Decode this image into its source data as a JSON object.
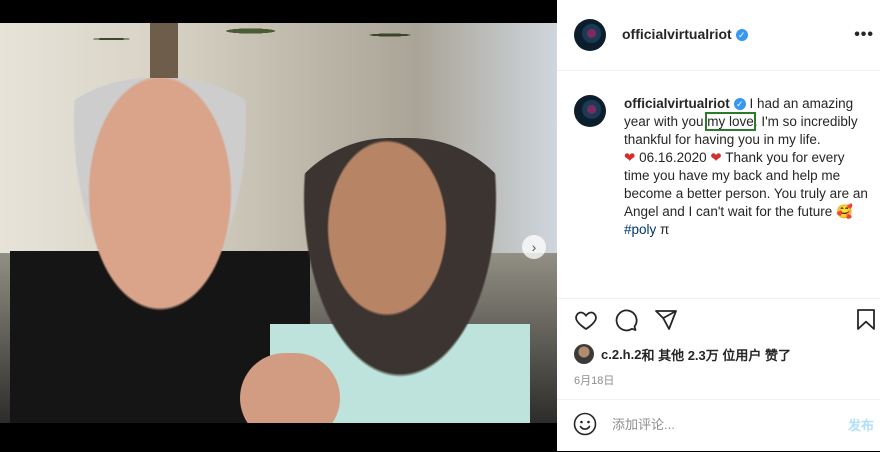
{
  "post": {
    "username": "officialvirtualriot",
    "caption": {
      "part1": "I had an amazing year with you ",
      "highlight": "my love",
      "part2": ". I'm so incredibly thankful for having you in my life.",
      "date_line": "06.16.2020",
      "part3": " Thank you for every time you have my back and help me become a better person. You truly are an Angel and I can't wait for the future",
      "hashtag": "#poly",
      "suffix": " π",
      "heart_emoji": "❤",
      "smile_emoji": "🥰"
    },
    "likes": {
      "liker": "c.2.h.2",
      "text": " 和 其他 2.3万 位用户 赞了"
    },
    "date": "6月18日"
  },
  "comment": {
    "placeholder": "添加评论...",
    "post_label": "发布"
  },
  "icons": {
    "more": "more-icon",
    "verified": "verified-badge-icon",
    "like": "heart-icon",
    "comment": "comment-icon",
    "share": "share-icon",
    "save": "bookmark-icon",
    "emoji": "emoji-icon",
    "next": "chevron-right-icon"
  },
  "colors": {
    "verified": "#3897f0",
    "hashtag": "#00376b",
    "highlight_box": "#2c7a2c",
    "post_button": "#b2dffc"
  },
  "carousel": {
    "slide_count": 3,
    "active_index": 0
  }
}
